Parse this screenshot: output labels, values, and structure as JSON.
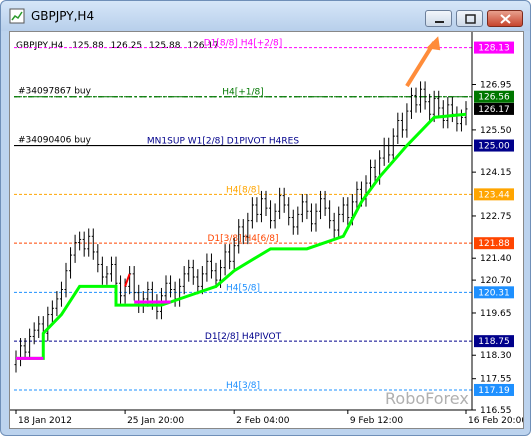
{
  "window": {
    "title": "GBPJPY,H4",
    "buttons": [
      "minimize",
      "maximize",
      "close"
    ]
  },
  "chart_header": {
    "symbol": "GBPJPY,H4",
    "open": "125.88",
    "high": "126.25",
    "low": "125.88",
    "close": "126.17"
  },
  "colors": {
    "background": "#ffffff",
    "candles": "#000000",
    "trail_up": "#00ff00",
    "trail_magenta": "#ff00ff",
    "trail_red": "#ff0000",
    "arrow": "#ff8c3a",
    "window_frame": "#bcd3ee"
  },
  "watermark": "RoboForex",
  "order_lines": [
    {
      "label": "#34097867 buy",
      "price": 126.56,
      "color": "#007700"
    },
    {
      "label": "#34090406 buy",
      "price": 125.0,
      "color": "#000000"
    }
  ],
  "levels": [
    {
      "label": "D1[8/8] H4[+2/8]",
      "price": 128.13,
      "price_label": "128.13",
      "color": "#ff00ff"
    },
    {
      "label": "H4[+1/8]",
      "price": 126.56,
      "price_label": "126.56",
      "color": "#007700"
    },
    {
      "label": "",
      "price": 126.17,
      "price_label": "126.17",
      "color": "#000000",
      "current": true
    },
    {
      "label": "MN1SUP W1[2/8] D1PIVOT H4RES",
      "price": 125.0,
      "price_label": "125.00",
      "color": "#00008b"
    },
    {
      "label": "H4[8/8]",
      "price": 123.44,
      "price_label": "123.44",
      "color": "#ffa500"
    },
    {
      "label": "D1[3/8] H4[6/8]",
      "price": 121.88,
      "price_label": "121.88",
      "color": "#ff4500"
    },
    {
      "label": "H4[5/8]",
      "price": 120.31,
      "price_label": "120.31",
      "color": "#1e90ff"
    },
    {
      "label": "D1[2/8] H4PIVOT",
      "price": 118.75,
      "price_label": "118.75",
      "color": "#00008b"
    },
    {
      "label": "H4[3/8]",
      "price": 117.19,
      "price_label": "117.19",
      "color": "#1e90ff"
    }
  ],
  "price_axis": [
    "126.95",
    "125.50",
    "124.15",
    "122.75",
    "121.40",
    "120.70",
    "119.65",
    "118.30",
    "117.55",
    "116.55"
  ],
  "time_axis": [
    "18 Jan 2012",
    "25 Jan 20:00",
    "2 Feb 04:00",
    "9 Feb 12:00",
    "16 Feb 20:00"
  ],
  "chart_data": {
    "type": "candlestick",
    "ylim": [
      116.55,
      128.5
    ],
    "series": [
      {
        "name": "",
        "x": [
          0,
          1,
          2,
          3,
          4,
          5,
          6,
          7,
          8,
          9,
          10,
          11,
          12,
          13,
          14,
          15,
          16,
          17,
          18,
          19,
          20,
          21,
          22,
          23,
          24,
          25,
          26,
          27,
          28,
          29,
          30,
          31,
          32,
          33,
          34,
          35,
          36,
          37,
          38,
          39,
          40,
          41,
          42,
          43,
          44,
          45,
          46,
          47,
          48,
          49,
          50,
          51,
          52,
          53,
          54,
          55,
          56,
          57,
          58,
          59,
          60,
          61,
          62,
          63,
          64,
          65,
          66,
          67,
          68,
          69,
          70,
          71,
          72,
          73,
          74,
          75,
          76,
          77,
          78,
          79,
          80,
          81,
          82,
          83,
          84,
          85,
          86,
          87,
          88,
          89,
          90,
          91,
          92,
          93,
          94,
          95,
          96,
          97,
          98,
          99
        ],
        "close": [
          118.2,
          118.6,
          118.4,
          118.9,
          119.1,
          119.3,
          119.0,
          119.6,
          119.8,
          120.1,
          120.4,
          121.0,
          121.5,
          121.9,
          122.0,
          121.7,
          122.1,
          121.6,
          121.2,
          120.8,
          120.9,
          121.2,
          120.6,
          120.2,
          120.5,
          120.9,
          120.3,
          119.9,
          120.1,
          120.4,
          120.0,
          119.7,
          120.2,
          120.6,
          120.4,
          120.1,
          120.5,
          120.9,
          121.1,
          120.8,
          120.5,
          120.9,
          121.3,
          121.0,
          120.7,
          121.1,
          121.6,
          121.3,
          121.8,
          122.4,
          122.1,
          122.6,
          123.1,
          122.8,
          123.3,
          123.0,
          122.6,
          122.9,
          123.4,
          123.1,
          122.7,
          122.4,
          122.8,
          123.2,
          122.9,
          122.5,
          122.9,
          123.3,
          123.0,
          122.6,
          122.3,
          122.8,
          123.1,
          122.7,
          123.2,
          123.6,
          123.3,
          123.8,
          124.3,
          124.0,
          124.6,
          125.0,
          124.7,
          125.3,
          125.8,
          125.5,
          126.1,
          126.6,
          126.3,
          126.8,
          126.4,
          126.0,
          126.5,
          126.2,
          125.8,
          126.3,
          126.0,
          125.7,
          125.9,
          126.17
        ]
      }
    ],
    "trail_up": [
      {
        "x": 0,
        "y": 118.2
      },
      {
        "x": 6,
        "y": 118.2
      },
      {
        "x": 6,
        "y": 119.0
      },
      {
        "x": 10,
        "y": 119.6
      },
      {
        "x": 14,
        "y": 120.5
      },
      {
        "x": 22,
        "y": 120.5
      },
      {
        "x": 22,
        "y": 119.9
      },
      {
        "x": 32,
        "y": 119.9
      },
      {
        "x": 38,
        "y": 120.2
      },
      {
        "x": 44,
        "y": 120.5
      },
      {
        "x": 48,
        "y": 121.0
      },
      {
        "x": 56,
        "y": 121.7
      },
      {
        "x": 64,
        "y": 121.7
      },
      {
        "x": 72,
        "y": 122.1
      },
      {
        "x": 76,
        "y": 123.2
      },
      {
        "x": 80,
        "y": 124.0
      },
      {
        "x": 86,
        "y": 125.0
      },
      {
        "x": 92,
        "y": 125.9
      },
      {
        "x": 99,
        "y": 126.0
      }
    ]
  }
}
